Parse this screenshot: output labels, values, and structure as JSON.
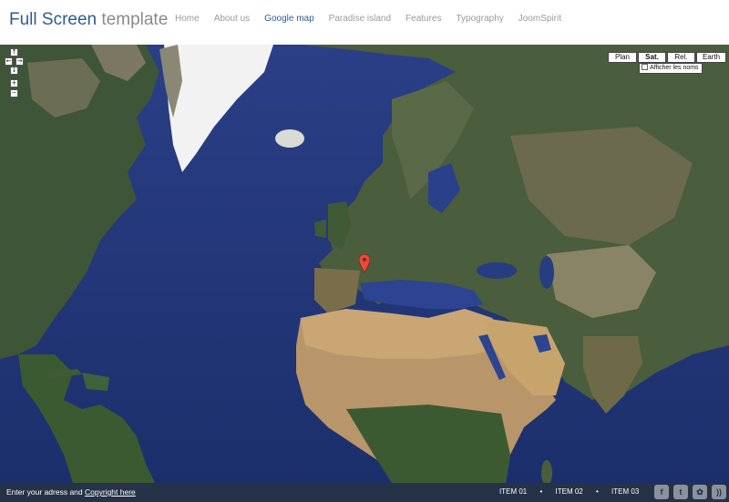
{
  "header": {
    "title_part1": "Full Screen",
    "title_part2": "template",
    "nav": [
      {
        "label": "Home"
      },
      {
        "label": "About us"
      },
      {
        "label": "Google map"
      },
      {
        "label": "Paradise island"
      },
      {
        "label": "Features"
      },
      {
        "label": "Typography"
      },
      {
        "label": "JoomSpirit"
      }
    ],
    "active_nav": "Google map"
  },
  "map": {
    "controls": {
      "up": "↑",
      "left": "←",
      "right": "→",
      "down": "↓",
      "zoom_in": "+",
      "zoom_out": "−"
    },
    "types": [
      {
        "label": "Plan",
        "selected": false
      },
      {
        "label": "Sat.",
        "selected": true
      },
      {
        "label": "Rel.",
        "selected": false
      },
      {
        "label": "Earth",
        "selected": false
      }
    ],
    "show_labels": "Afficher les noms",
    "marker_color": "#e64a3a"
  },
  "footer": {
    "address_text": "Enter your adress and",
    "copyright_link": "Copyright here",
    "items": [
      "ITEM 01",
      "ITEM 02",
      "ITEM 03"
    ],
    "separator": "•",
    "social": [
      {
        "icon": "facebook-icon",
        "glyph": "f"
      },
      {
        "icon": "twitter-icon",
        "glyph": "t"
      },
      {
        "icon": "flickr-icon",
        "glyph": "✿"
      },
      {
        "icon": "rss-icon",
        "glyph": "))"
      }
    ]
  }
}
